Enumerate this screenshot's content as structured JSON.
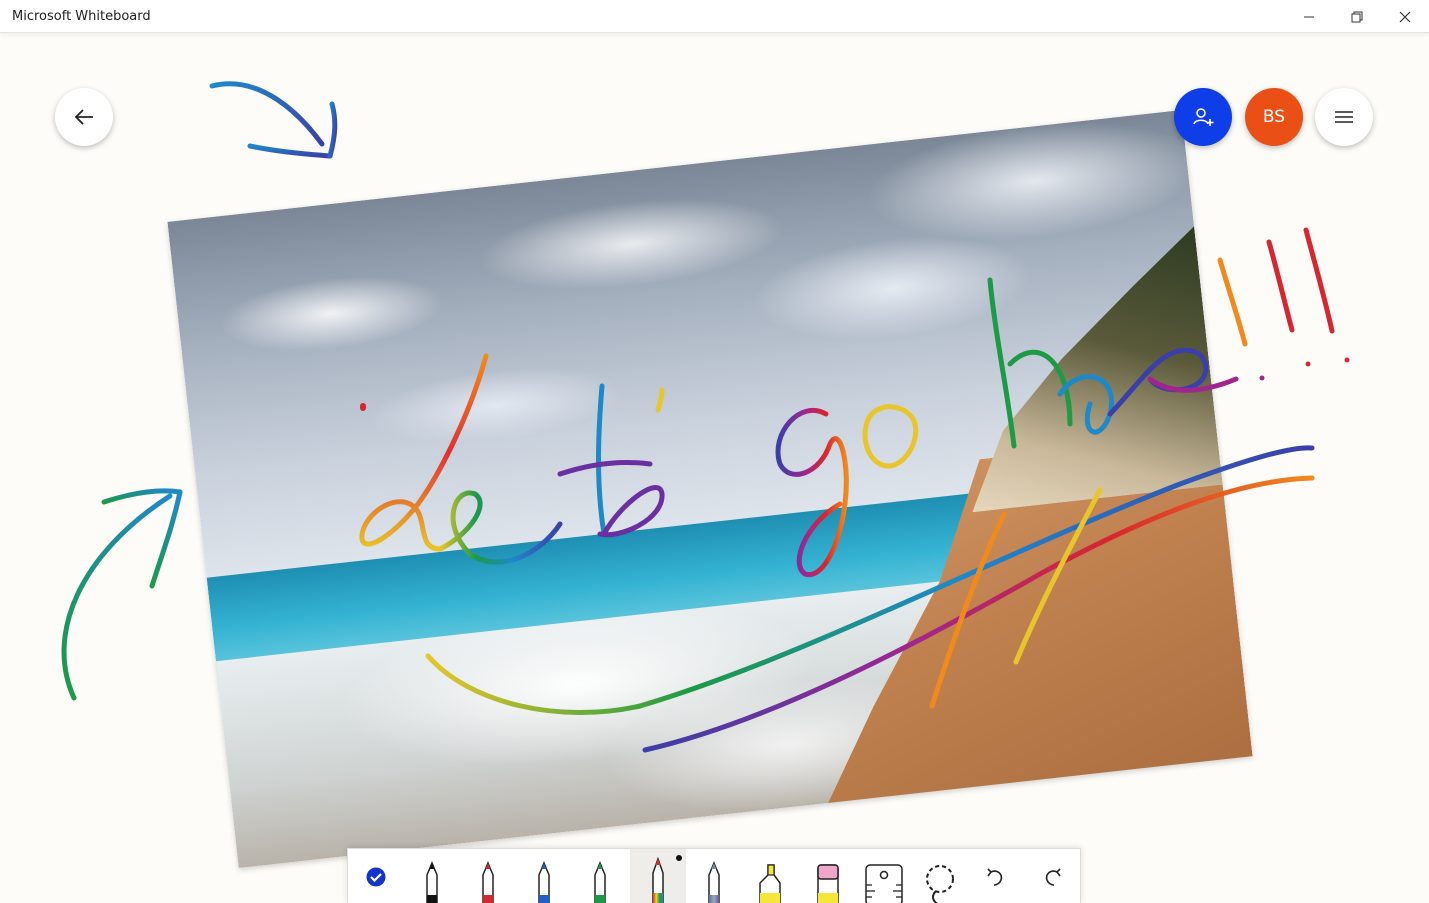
{
  "window": {
    "title": "Microsoft Whiteboard",
    "controls": [
      "minimize-icon",
      "restore-icon",
      "close-icon"
    ]
  },
  "top_right": {
    "invite_icon": "add-person-icon",
    "user_initials": "BS",
    "menu_icon": "hamburger-icon"
  },
  "colors": {
    "invite": "#0f3ee8",
    "avatar": "#ea4f15"
  },
  "toolbar": {
    "tools": [
      {
        "name": "select",
        "icon": "check-icon"
      },
      {
        "name": "pen-black",
        "icon": "pen-icon",
        "color": "#111111"
      },
      {
        "name": "pen-red",
        "icon": "pen-icon",
        "color": "#d9262e"
      },
      {
        "name": "pen-blue",
        "icon": "pen-icon",
        "color": "#1e5fc9"
      },
      {
        "name": "pen-green",
        "icon": "pen-icon",
        "color": "#1c9a45"
      },
      {
        "name": "pen-rainbow",
        "icon": "pen-icon",
        "color": "rainbow",
        "active": true
      },
      {
        "name": "pen-galaxy",
        "icon": "pen-icon",
        "color": "#7a8ca8"
      },
      {
        "name": "highlighter",
        "icon": "highlighter-icon",
        "color": "#f5e63a"
      },
      {
        "name": "eraser",
        "icon": "eraser-icon",
        "color": "#f0a6c8"
      },
      {
        "name": "ruler",
        "icon": "ruler-icon"
      },
      {
        "name": "lasso",
        "icon": "lasso-icon"
      },
      {
        "name": "undo",
        "icon": "undo-icon"
      },
      {
        "name": "redo",
        "icon": "redo-icon"
      }
    ]
  }
}
